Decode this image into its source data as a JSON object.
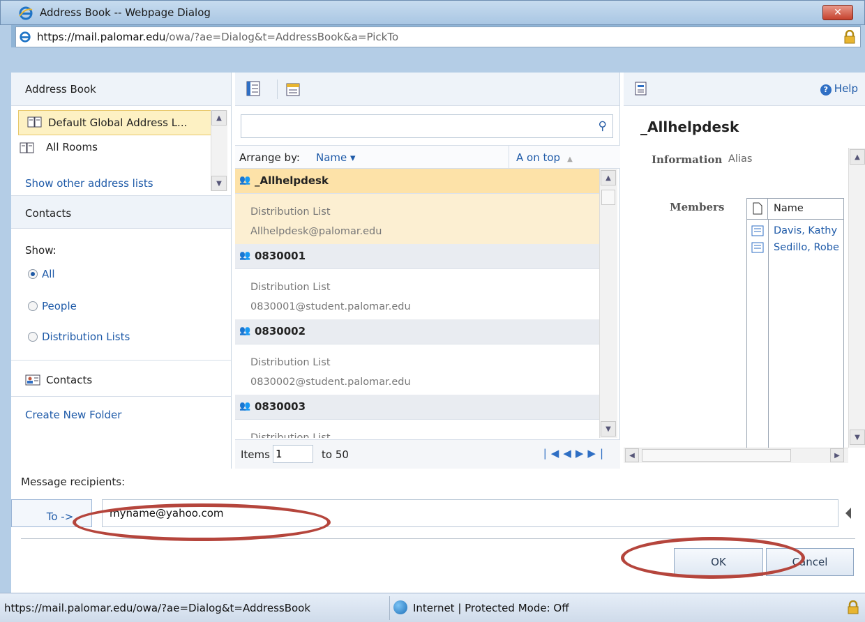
{
  "window": {
    "title": "Address Book -- Webpage Dialog",
    "close_label": "✕"
  },
  "address_bar": {
    "url_scheme": "https://",
    "url_host": "mail.palomar.edu",
    "url_path": "/owa/?ae=Dialog&t=AddressBook&a=PickTo"
  },
  "left_pane": {
    "header": "Address Book",
    "books": [
      {
        "label": "Default Global Address L...",
        "selected": true
      },
      {
        "label": "All Rooms",
        "selected": false
      }
    ],
    "cutoff_link": "Show other address lists",
    "contacts_header": "Contacts",
    "show_label": "Show:",
    "filters": [
      {
        "label": "All",
        "checked": true
      },
      {
        "label": "People",
        "checked": false
      },
      {
        "label": "Distribution Lists",
        "checked": false
      }
    ],
    "contacts_folder": "Contacts",
    "create_folder": "Create New Folder"
  },
  "middle_pane": {
    "search_value": "",
    "arrange_label": "Arrange by:",
    "arrange_by": "Name ▾",
    "order": "A on top",
    "entries": [
      {
        "name": "_Allhelpdesk",
        "type": "Distribution List",
        "email": "Allhelpdesk@palomar.edu",
        "selected": true
      },
      {
        "name": "0830001",
        "type": "Distribution List",
        "email": "0830001@student.palomar.edu",
        "selected": false
      },
      {
        "name": "0830002",
        "type": "Distribution List",
        "email": "0830002@student.palomar.edu",
        "selected": false
      },
      {
        "name": "0830003",
        "type": "Distribution List",
        "email": "",
        "selected": false
      }
    ],
    "pager": {
      "items_label": "Items",
      "from_value": "1",
      "to_label": "to 50"
    }
  },
  "right_pane": {
    "help_label": "Help",
    "display_name": "_Allhelpdesk",
    "information_label": "Information",
    "alias_label": "Alias",
    "members_label": "Members",
    "members_column": "Name",
    "members": [
      "Davis, Kathy",
      "Sedillo, Robe"
    ]
  },
  "recipients": {
    "label": "Message recipients:",
    "to_button": "To ->",
    "value": "myname@yahoo.com"
  },
  "buttons": {
    "ok": "OK",
    "cancel": "Cancel"
  },
  "status_bar": {
    "url": "https://mail.palomar.edu/owa/?ae=Dialog&t=AddressBook",
    "zone": "Internet | Protected Mode: Off"
  },
  "colors": {
    "accent_link": "#1e5aa8",
    "selection": "#fde2a8",
    "annotation": "#b5453c"
  }
}
